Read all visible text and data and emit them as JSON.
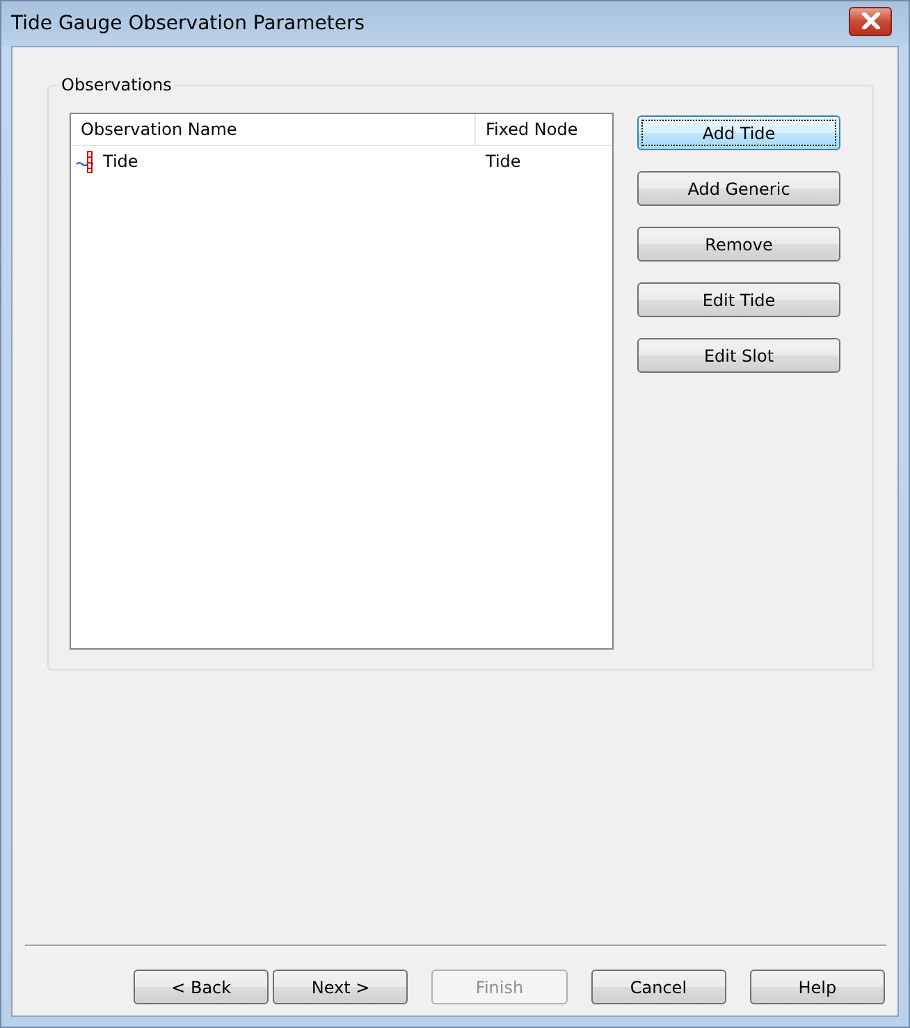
{
  "window": {
    "title": "Tide Gauge Observation Parameters"
  },
  "observations": {
    "title": "Observations",
    "columns": [
      "Observation Name",
      "Fixed Node"
    ],
    "rows": [
      {
        "name": "Tide",
        "fixed_node": "Tide",
        "selected": false
      }
    ],
    "buttons": [
      {
        "label": "Add Tide",
        "focused": true,
        "disabled": false
      },
      {
        "label": "Add Generic",
        "focused": false,
        "disabled": false
      },
      {
        "label": "Remove",
        "focused": false,
        "disabled": false
      },
      {
        "label": "Edit Tide",
        "focused": false,
        "disabled": false
      },
      {
        "label": "Edit Slot",
        "focused": false,
        "disabled": false
      }
    ]
  },
  "footer_buttons": [
    {
      "label": "< Back",
      "disabled": false
    },
    {
      "label": "Next >",
      "disabled": false
    },
    {
      "label": "Finish",
      "disabled": true
    },
    {
      "label": "Cancel",
      "disabled": false
    },
    {
      "label": "Help",
      "disabled": false
    }
  ]
}
